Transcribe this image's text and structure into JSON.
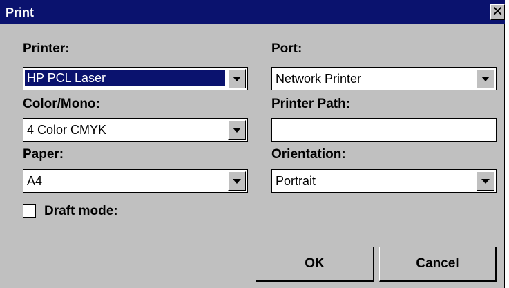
{
  "window": {
    "title": "Print",
    "close_glyph": "✕"
  },
  "printer": {
    "label": "Printer:",
    "value": "HP PCL Laser"
  },
  "port": {
    "label": "Port:",
    "value": "Network Printer"
  },
  "color_mono": {
    "label": "Color/Mono:",
    "value": "4 Color CMYK"
  },
  "printer_path": {
    "label": "Printer Path:",
    "value": ""
  },
  "paper": {
    "label": "Paper:",
    "value": "A4"
  },
  "orientation": {
    "label": "Orientation:",
    "value": "Portrait"
  },
  "draft_mode": {
    "label": "Draft mode:",
    "checked": false
  },
  "buttons": {
    "ok": "OK",
    "cancel": "Cancel"
  },
  "colors": {
    "titlebar": "#0a126e",
    "face": "#c0c0c0",
    "selection": "#0a126e"
  }
}
